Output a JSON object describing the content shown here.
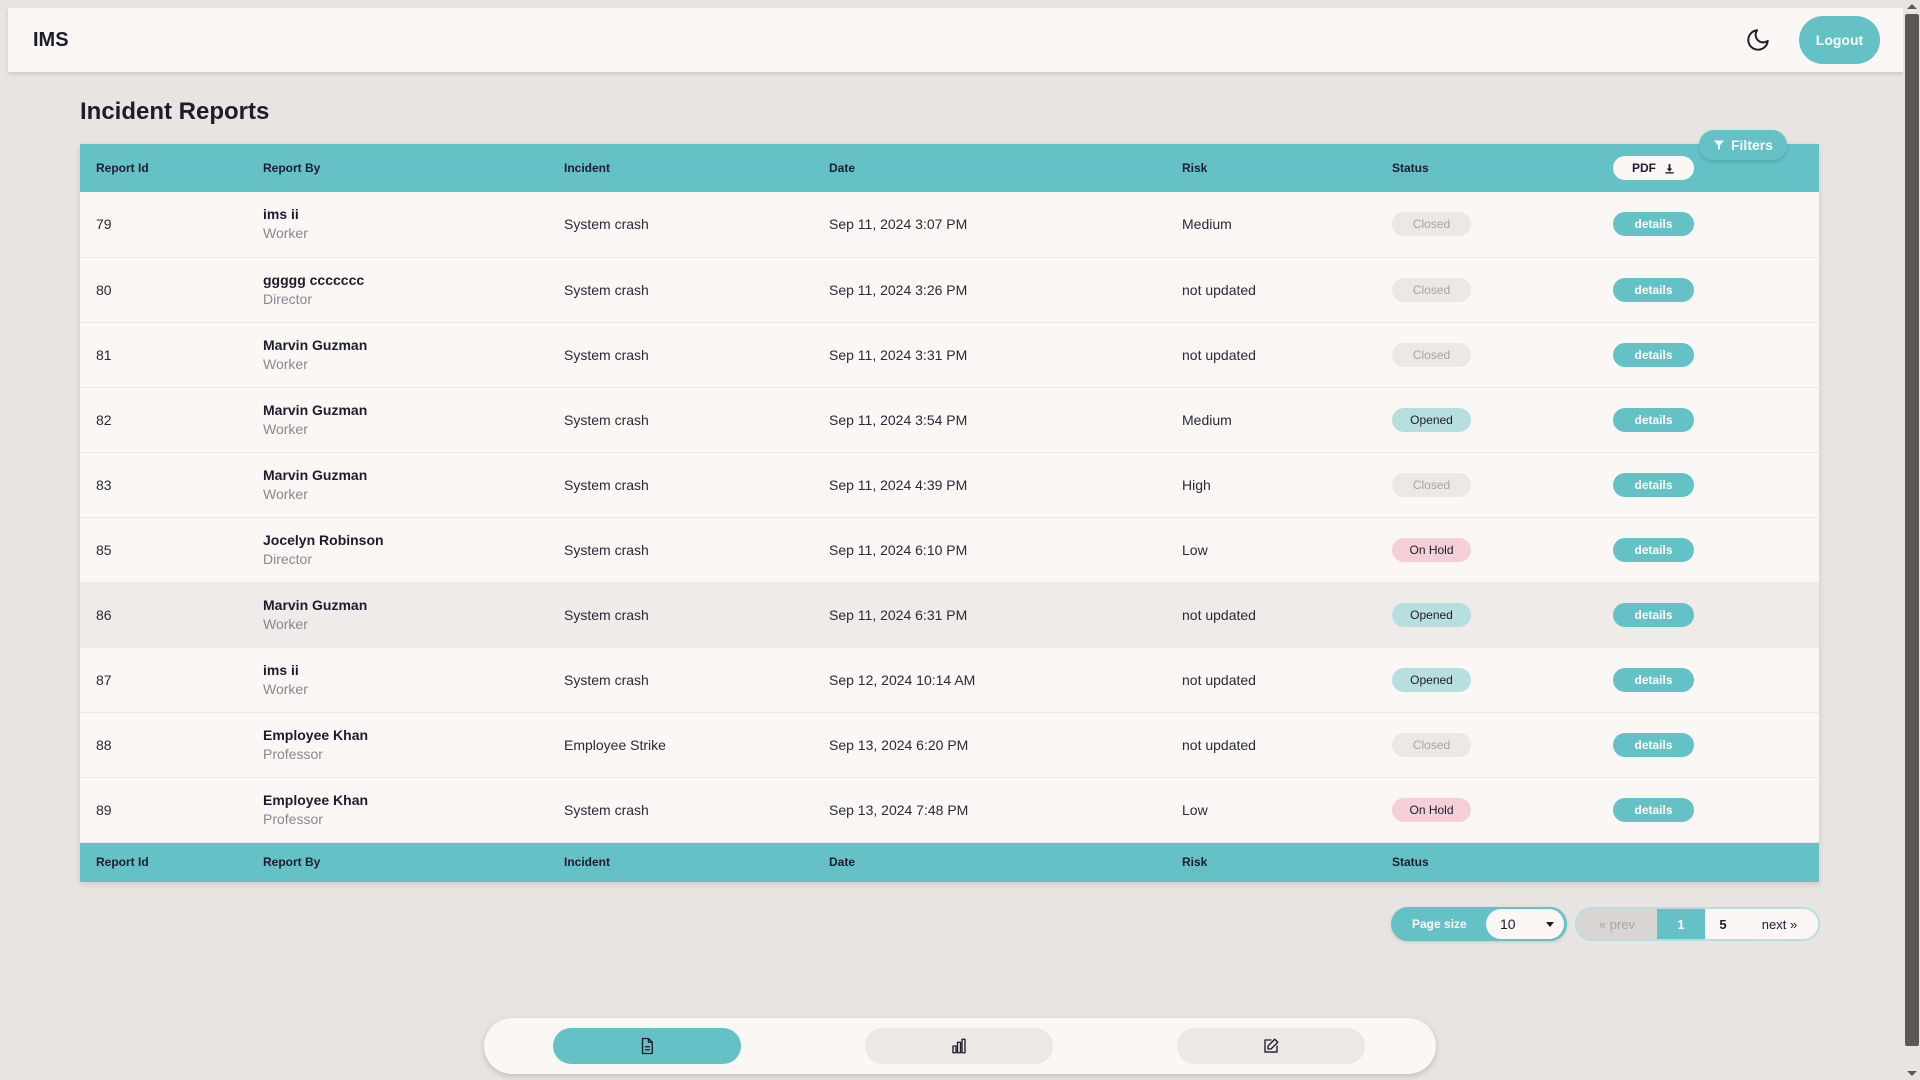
{
  "app": {
    "brand": "IMS",
    "logout_label": "Logout"
  },
  "page": {
    "title": "Incident Reports"
  },
  "table": {
    "columns": [
      "Report Id",
      "Report By",
      "Incident",
      "Date",
      "Risk",
      "Status"
    ],
    "pdf_label": "PDF",
    "filters_label": "Filters",
    "details_label": "details",
    "rows": [
      {
        "id": "79",
        "name": "ims ii",
        "role": "Worker",
        "incident": "System crash",
        "date": "Sep 11, 2024 3:07 PM",
        "risk": "Medium",
        "status": "Closed"
      },
      {
        "id": "80",
        "name": "ggggg ccccccc",
        "role": "Director",
        "incident": "System crash",
        "date": "Sep 11, 2024 3:26 PM",
        "risk": "not updated",
        "status": "Closed"
      },
      {
        "id": "81",
        "name": "Marvin Guzman",
        "role": "Worker",
        "incident": "System crash",
        "date": "Sep 11, 2024 3:31 PM",
        "risk": "not updated",
        "status": "Closed"
      },
      {
        "id": "82",
        "name": "Marvin Guzman",
        "role": "Worker",
        "incident": "System crash",
        "date": "Sep 11, 2024 3:54 PM",
        "risk": "Medium",
        "status": "Opened"
      },
      {
        "id": "83",
        "name": "Marvin Guzman",
        "role": "Worker",
        "incident": "System crash",
        "date": "Sep 11, 2024 4:39 PM",
        "risk": "High",
        "status": "Closed"
      },
      {
        "id": "85",
        "name": "Jocelyn Robinson",
        "role": "Director",
        "incident": "System crash",
        "date": "Sep 11, 2024 6:10 PM",
        "risk": "Low",
        "status": "On Hold"
      },
      {
        "id": "86",
        "name": "Marvin Guzman",
        "role": "Worker",
        "incident": "System crash",
        "date": "Sep 11, 2024 6:31 PM",
        "risk": "not updated",
        "status": "Opened"
      },
      {
        "id": "87",
        "name": "ims ii",
        "role": "Worker",
        "incident": "System crash",
        "date": "Sep 12, 2024 10:14 AM",
        "risk": "not updated",
        "status": "Opened"
      },
      {
        "id": "88",
        "name": "Employee Khan",
        "role": "Professor",
        "incident": "Employee Strike",
        "date": "Sep 13, 2024 6:20 PM",
        "risk": "not updated",
        "status": "Closed"
      },
      {
        "id": "89",
        "name": "Employee Khan",
        "role": "Professor",
        "incident": "System crash",
        "date": "Sep 13, 2024 7:48 PM",
        "risk": "Low",
        "status": "On Hold"
      }
    ]
  },
  "pagination": {
    "page_size_label": "Page size",
    "page_size_value": "10",
    "prev_label": "« prev",
    "current_page": "1",
    "last_page": "5",
    "next_label": "next »"
  },
  "bottom_nav": {
    "items": [
      {
        "icon": "document-icon",
        "active": true
      },
      {
        "icon": "bar-chart-icon",
        "active": false
      },
      {
        "icon": "edit-icon",
        "active": false
      }
    ]
  },
  "colors": {
    "accent": "#64c2c6",
    "background": "#e8e4e1",
    "surface": "#faf7f4",
    "closed_badge": "#ece8e5",
    "opened_badge": "#b7dfe0",
    "onhold_badge": "#f5cfd6"
  }
}
